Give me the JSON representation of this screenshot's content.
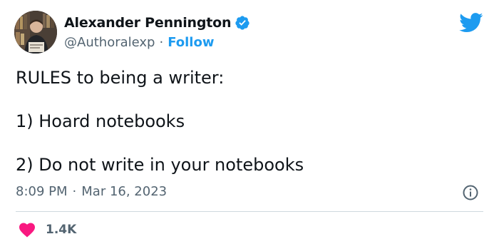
{
  "user": {
    "display_name": "Alexander Pennington",
    "handle": "@Authoralexp",
    "separator": "·",
    "follow_label": "Follow",
    "verified": true
  },
  "tweet": {
    "lines": [
      "RULES to being a writer:",
      "1) Hoard notebooks",
      "2) Do not write in your notebooks"
    ],
    "time": "8:09 PM",
    "separator": "·",
    "date": "Mar 16, 2023"
  },
  "engagement": {
    "likes": "1.4K"
  },
  "colors": {
    "brand": "#1d9bf0",
    "heart": "#f91880",
    "secondary_text": "#536471",
    "primary_text": "#0f1419"
  },
  "icons": {
    "brand": "twitter-bird-icon",
    "verified": "verified-badge-icon",
    "info": "info-icon",
    "like": "heart-icon"
  }
}
